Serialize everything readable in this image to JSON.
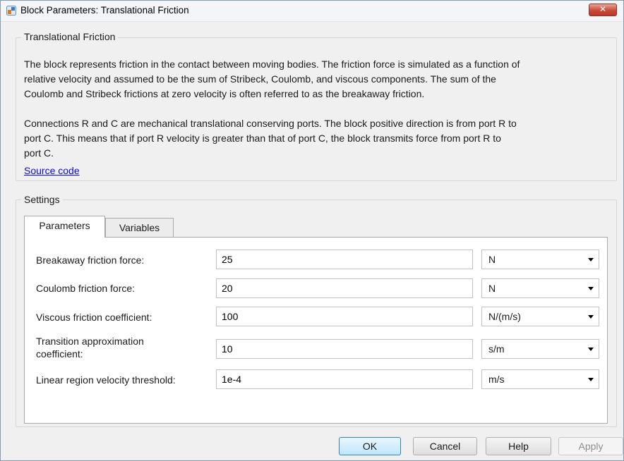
{
  "window": {
    "title": "Block Parameters: Translational Friction",
    "close_glyph": "✕"
  },
  "description": {
    "group_title": "Translational Friction",
    "paragraph1_lines": [
      "The block represents friction in the contact between moving bodies. The friction force is simulated as a function of",
      "relative velocity and assumed to be the sum of Stribeck, Coulomb, and viscous components. The sum of the",
      "Coulomb and Stribeck frictions at zero velocity is often referred to as the breakaway friction."
    ],
    "paragraph2_lines": [
      "Connections R and C are mechanical translational conserving ports. The block positive direction is from port R to",
      "port C. This means that if port R velocity is greater than that of port C, the block transmits force from port R to",
      "port C."
    ],
    "link": "Source code"
  },
  "settings": {
    "group_title": "Settings",
    "tabs": [
      {
        "label": "Parameters",
        "active": true
      },
      {
        "label": "Variables",
        "active": false
      }
    ],
    "parameters": [
      {
        "label": "Breakaway friction force:",
        "value": "25",
        "unit": "N"
      },
      {
        "label": "Coulomb friction force:",
        "value": "20",
        "unit": "N"
      },
      {
        "label": "Viscous friction coefficient:",
        "value": "100",
        "unit": "N/(m/s)"
      },
      {
        "label_lines": [
          "Transition approximation",
          "coefficient:"
        ],
        "value": "10",
        "unit": "s/m"
      },
      {
        "label": "Linear region velocity threshold:",
        "value": "1e-4",
        "unit": "m/s"
      }
    ]
  },
  "buttons": {
    "ok": "OK",
    "cancel": "Cancel",
    "help": "Help",
    "apply": "Apply"
  },
  "colors": {
    "link": "#0b0bd4",
    "close_button": "#c94a3a",
    "default_button_border": "#3c7fb1"
  },
  "icons": {
    "app": "block-parameters-icon",
    "close": "close-icon",
    "dropdown": "chevron-down-icon"
  }
}
